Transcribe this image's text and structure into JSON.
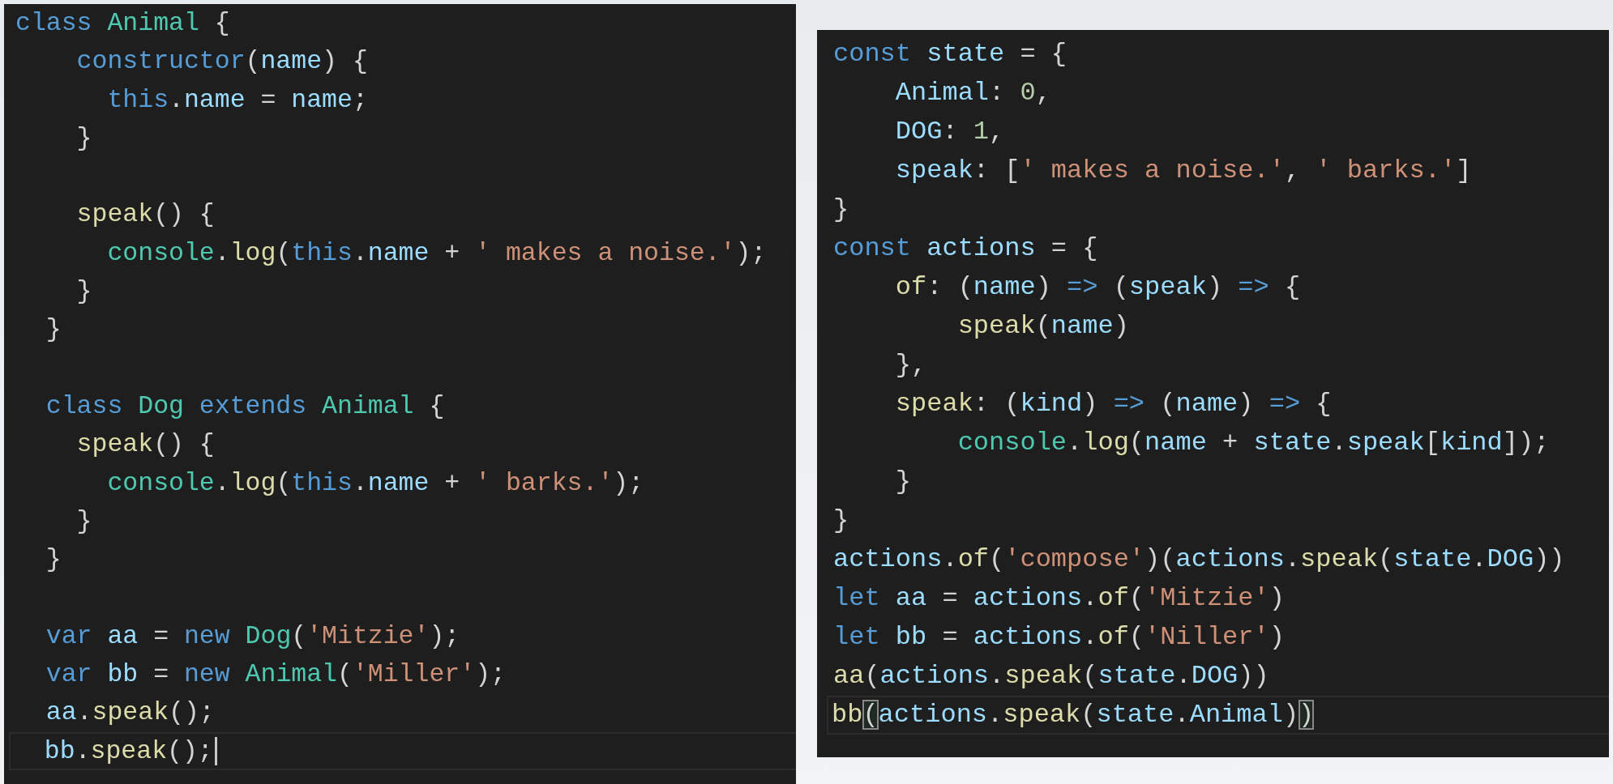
{
  "panels": [
    {
      "cursor_visible": true,
      "lines": [
        {
          "current": false,
          "tokens": [
            {
              "kind": "kw",
              "text": "class"
            },
            {
              "kind": "type",
              "text": " Animal"
            },
            {
              "kind": "p",
              "text": " {"
            }
          ]
        },
        {
          "current": false,
          "tokens": [
            {
              "kind": "kw",
              "text": "    constructor"
            },
            {
              "kind": "p",
              "text": "("
            },
            {
              "kind": "var",
              "text": "name"
            },
            {
              "kind": "p",
              "text": ") {"
            }
          ]
        },
        {
          "current": false,
          "tokens": [
            {
              "kind": "kw",
              "text": "      this"
            },
            {
              "kind": "p",
              "text": "."
            },
            {
              "kind": "var",
              "text": "name"
            },
            {
              "kind": "p",
              "text": " = "
            },
            {
              "kind": "var",
              "text": "name"
            },
            {
              "kind": "p",
              "text": ";"
            }
          ]
        },
        {
          "current": false,
          "tokens": [
            {
              "kind": "p",
              "text": "    }"
            }
          ]
        },
        {
          "current": false
        },
        {
          "current": false,
          "tokens": [
            {
              "kind": "fn",
              "text": "    speak"
            },
            {
              "kind": "p",
              "text": "() {"
            }
          ]
        },
        {
          "current": false,
          "tokens": [
            {
              "kind": "type",
              "text": "      console"
            },
            {
              "kind": "p",
              "text": "."
            },
            {
              "kind": "fn",
              "text": "log"
            },
            {
              "kind": "p",
              "text": "("
            },
            {
              "kind": "kw",
              "text": "this"
            },
            {
              "kind": "p",
              "text": "."
            },
            {
              "kind": "var",
              "text": "name"
            },
            {
              "kind": "p",
              "text": " + "
            },
            {
              "kind": "str",
              "text": "' makes a noise.'"
            },
            {
              "kind": "p",
              "text": ");"
            }
          ]
        },
        {
          "current": false,
          "tokens": [
            {
              "kind": "p",
              "text": "    }"
            }
          ]
        },
        {
          "current": false,
          "tokens": [
            {
              "kind": "p",
              "text": "  }"
            }
          ]
        },
        {
          "current": false
        },
        {
          "current": false,
          "tokens": [
            {
              "kind": "kw",
              "text": "  class"
            },
            {
              "kind": "type",
              "text": " Dog"
            },
            {
              "kind": "kw",
              "text": " extends"
            },
            {
              "kind": "type",
              "text": " Animal"
            },
            {
              "kind": "p",
              "text": " {"
            }
          ]
        },
        {
          "current": false,
          "tokens": [
            {
              "kind": "fn",
              "text": "    speak"
            },
            {
              "kind": "p",
              "text": "() {"
            }
          ]
        },
        {
          "current": false,
          "tokens": [
            {
              "kind": "type",
              "text": "      console"
            },
            {
              "kind": "p",
              "text": "."
            },
            {
              "kind": "fn",
              "text": "log"
            },
            {
              "kind": "p",
              "text": "("
            },
            {
              "kind": "kw",
              "text": "this"
            },
            {
              "kind": "p",
              "text": "."
            },
            {
              "kind": "var",
              "text": "name"
            },
            {
              "kind": "p",
              "text": " + "
            },
            {
              "kind": "str",
              "text": "' barks.'"
            },
            {
              "kind": "p",
              "text": ");"
            }
          ]
        },
        {
          "current": false,
          "tokens": [
            {
              "kind": "p",
              "text": "    }"
            }
          ]
        },
        {
          "current": false,
          "tokens": [
            {
              "kind": "p",
              "text": "  }"
            }
          ]
        },
        {
          "current": false
        },
        {
          "current": false,
          "tokens": [
            {
              "kind": "kw",
              "text": "  var"
            },
            {
              "kind": "var",
              "text": " aa"
            },
            {
              "kind": "p",
              "text": " = "
            },
            {
              "kind": "kw",
              "text": "new"
            },
            {
              "kind": "type",
              "text": " Dog"
            },
            {
              "kind": "p",
              "text": "("
            },
            {
              "kind": "str",
              "text": "'Mitzie'"
            },
            {
              "kind": "p",
              "text": ");"
            }
          ]
        },
        {
          "current": false,
          "tokens": [
            {
              "kind": "kw",
              "text": "  var"
            },
            {
              "kind": "var",
              "text": " bb"
            },
            {
              "kind": "p",
              "text": " = "
            },
            {
              "kind": "kw",
              "text": "new"
            },
            {
              "kind": "type",
              "text": " Animal"
            },
            {
              "kind": "p",
              "text": "("
            },
            {
              "kind": "str",
              "text": "'Miller'"
            },
            {
              "kind": "p",
              "text": ");"
            }
          ]
        },
        {
          "current": false,
          "tokens": [
            {
              "kind": "var",
              "text": "  aa"
            },
            {
              "kind": "p",
              "text": "."
            },
            {
              "kind": "fn",
              "text": "speak"
            },
            {
              "kind": "p",
              "text": "();"
            }
          ]
        },
        {
          "current": true,
          "tokens": [
            {
              "kind": "var",
              "text": "  bb"
            },
            {
              "kind": "p",
              "text": "."
            },
            {
              "kind": "fn",
              "text": "speak"
            },
            {
              "kind": "p",
              "text": "();"
            }
          ]
        }
      ]
    },
    {
      "cursor_visible": false,
      "lines": [
        {
          "current": false,
          "tokens": [
            {
              "kind": "kw",
              "text": "const"
            },
            {
              "kind": "var",
              "text": " state"
            },
            {
              "kind": "p",
              "text": " = {"
            }
          ]
        },
        {
          "current": false,
          "tokens": [
            {
              "kind": "var",
              "text": "    Animal"
            },
            {
              "kind": "p",
              "text": ": "
            },
            {
              "kind": "num",
              "text": "0"
            },
            {
              "kind": "p",
              "text": ","
            }
          ]
        },
        {
          "current": false,
          "tokens": [
            {
              "kind": "var",
              "text": "    DOG"
            },
            {
              "kind": "p",
              "text": ": "
            },
            {
              "kind": "num",
              "text": "1"
            },
            {
              "kind": "p",
              "text": ","
            }
          ]
        },
        {
          "current": false,
          "tokens": [
            {
              "kind": "var",
              "text": "    speak"
            },
            {
              "kind": "p",
              "text": ": ["
            },
            {
              "kind": "str",
              "text": "' makes a noise.'"
            },
            {
              "kind": "p",
              "text": ", "
            },
            {
              "kind": "str",
              "text": "' barks.'"
            },
            {
              "kind": "p",
              "text": "]"
            }
          ]
        },
        {
          "current": false,
          "tokens": [
            {
              "kind": "p",
              "text": "}"
            }
          ]
        },
        {
          "current": false,
          "tokens": [
            {
              "kind": "kw",
              "text": "const"
            },
            {
              "kind": "var",
              "text": " actions"
            },
            {
              "kind": "p",
              "text": " = {"
            }
          ]
        },
        {
          "current": false,
          "tokens": [
            {
              "kind": "fn",
              "text": "    of"
            },
            {
              "kind": "p",
              "text": ": ("
            },
            {
              "kind": "var",
              "text": "name"
            },
            {
              "kind": "p",
              "text": ") "
            },
            {
              "kind": "kw",
              "text": "=>"
            },
            {
              "kind": "p",
              "text": " ("
            },
            {
              "kind": "var",
              "text": "speak"
            },
            {
              "kind": "p",
              "text": ") "
            },
            {
              "kind": "kw",
              "text": "=>"
            },
            {
              "kind": "p",
              "text": " {"
            }
          ]
        },
        {
          "current": false,
          "tokens": [
            {
              "kind": "fn",
              "text": "        speak"
            },
            {
              "kind": "p",
              "text": "("
            },
            {
              "kind": "var",
              "text": "name"
            },
            {
              "kind": "p",
              "text": ")"
            }
          ]
        },
        {
          "current": false,
          "tokens": [
            {
              "kind": "p",
              "text": "    },"
            }
          ]
        },
        {
          "current": false,
          "tokens": [
            {
              "kind": "fn",
              "text": "    speak"
            },
            {
              "kind": "p",
              "text": ": ("
            },
            {
              "kind": "var",
              "text": "kind"
            },
            {
              "kind": "p",
              "text": ") "
            },
            {
              "kind": "kw",
              "text": "=>"
            },
            {
              "kind": "p",
              "text": " ("
            },
            {
              "kind": "var",
              "text": "name"
            },
            {
              "kind": "p",
              "text": ") "
            },
            {
              "kind": "kw",
              "text": "=>"
            },
            {
              "kind": "p",
              "text": " {"
            }
          ]
        },
        {
          "current": false,
          "tokens": [
            {
              "kind": "type",
              "text": "        console"
            },
            {
              "kind": "p",
              "text": "."
            },
            {
              "kind": "fn",
              "text": "log"
            },
            {
              "kind": "p",
              "text": "("
            },
            {
              "kind": "var",
              "text": "name"
            },
            {
              "kind": "p",
              "text": " + "
            },
            {
              "kind": "var",
              "text": "state"
            },
            {
              "kind": "p",
              "text": "."
            },
            {
              "kind": "var",
              "text": "speak"
            },
            {
              "kind": "p",
              "text": "["
            },
            {
              "kind": "var",
              "text": "kind"
            },
            {
              "kind": "p",
              "text": "]);"
            }
          ]
        },
        {
          "current": false,
          "tokens": [
            {
              "kind": "p",
              "text": "    }"
            }
          ]
        },
        {
          "current": false,
          "tokens": [
            {
              "kind": "p",
              "text": "}"
            }
          ]
        },
        {
          "current": false,
          "tokens": [
            {
              "kind": "var",
              "text": "actions"
            },
            {
              "kind": "p",
              "text": "."
            },
            {
              "kind": "fn",
              "text": "of"
            },
            {
              "kind": "p",
              "text": "("
            },
            {
              "kind": "str",
              "text": "'compose'"
            },
            {
              "kind": "p",
              "text": ")("
            },
            {
              "kind": "var",
              "text": "actions"
            },
            {
              "kind": "p",
              "text": "."
            },
            {
              "kind": "fn",
              "text": "speak"
            },
            {
              "kind": "p",
              "text": "("
            },
            {
              "kind": "var",
              "text": "state"
            },
            {
              "kind": "p",
              "text": "."
            },
            {
              "kind": "var",
              "text": "DOG"
            },
            {
              "kind": "p",
              "text": "))"
            }
          ]
        },
        {
          "current": false,
          "tokens": [
            {
              "kind": "kw",
              "text": "let"
            },
            {
              "kind": "var",
              "text": " aa"
            },
            {
              "kind": "p",
              "text": " = "
            },
            {
              "kind": "var",
              "text": "actions"
            },
            {
              "kind": "p",
              "text": "."
            },
            {
              "kind": "fn",
              "text": "of"
            },
            {
              "kind": "p",
              "text": "("
            },
            {
              "kind": "str",
              "text": "'Mitzie'"
            },
            {
              "kind": "p",
              "text": ")"
            }
          ]
        },
        {
          "current": false,
          "tokens": [
            {
              "kind": "kw",
              "text": "let"
            },
            {
              "kind": "var",
              "text": " bb"
            },
            {
              "kind": "p",
              "text": " = "
            },
            {
              "kind": "var",
              "text": "actions"
            },
            {
              "kind": "p",
              "text": "."
            },
            {
              "kind": "fn",
              "text": "of"
            },
            {
              "kind": "p",
              "text": "("
            },
            {
              "kind": "str",
              "text": "'Niller'"
            },
            {
              "kind": "p",
              "text": ")"
            }
          ]
        },
        {
          "current": false,
          "tokens": [
            {
              "kind": "fn",
              "text": "aa"
            },
            {
              "kind": "p",
              "text": "("
            },
            {
              "kind": "var",
              "text": "actions"
            },
            {
              "kind": "p",
              "text": "."
            },
            {
              "kind": "fn",
              "text": "speak"
            },
            {
              "kind": "p",
              "text": "("
            },
            {
              "kind": "var",
              "text": "state"
            },
            {
              "kind": "p",
              "text": "."
            },
            {
              "kind": "var",
              "text": "DOG"
            },
            {
              "kind": "p",
              "text": "))"
            }
          ]
        },
        {
          "current": true,
          "tokens": [
            {
              "kind": "fn",
              "text": "bb"
            },
            {
              "kind": "match",
              "text": "("
            },
            {
              "kind": "var",
              "text": "actions"
            },
            {
              "kind": "p",
              "text": "."
            },
            {
              "kind": "fn",
              "text": "speak"
            },
            {
              "kind": "p",
              "text": "("
            },
            {
              "kind": "var",
              "text": "state"
            },
            {
              "kind": "p",
              "text": "."
            },
            {
              "kind": "var",
              "text": "Animal"
            },
            {
              "kind": "p",
              "text": ")"
            },
            {
              "kind": "match",
              "text": ")"
            }
          ]
        }
      ]
    }
  ]
}
